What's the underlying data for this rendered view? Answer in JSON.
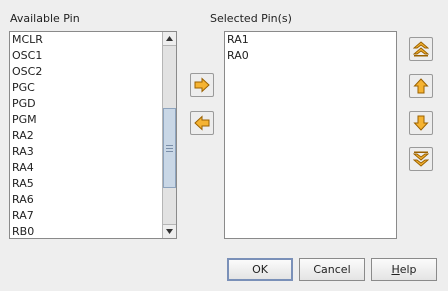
{
  "available": {
    "label": "Available Pin",
    "items": [
      "MCLR",
      "OSC1",
      "OSC2",
      "PGC",
      "PGD",
      "PGM",
      "RA2",
      "RA3",
      "RA4",
      "RA5",
      "RA6",
      "RA7",
      "RB0"
    ]
  },
  "selected": {
    "label": "Selected Pin(s)",
    "items": [
      "RA1",
      "RA0"
    ]
  },
  "transfer": {
    "add_icon": "arrow-right-icon",
    "remove_icon": "arrow-left-icon"
  },
  "order": {
    "top_icon": "double-chevron-up-icon",
    "up_icon": "arrow-up-icon",
    "down_icon": "arrow-down-icon",
    "bottom_icon": "double-chevron-down-icon"
  },
  "buttons": {
    "ok": "OK",
    "cancel": "Cancel",
    "help_prefix": "",
    "help_mnemonic": "H",
    "help_rest": "elp"
  },
  "colors": {
    "icon_fill": "#f5b332",
    "icon_stroke": "#9a6100"
  }
}
